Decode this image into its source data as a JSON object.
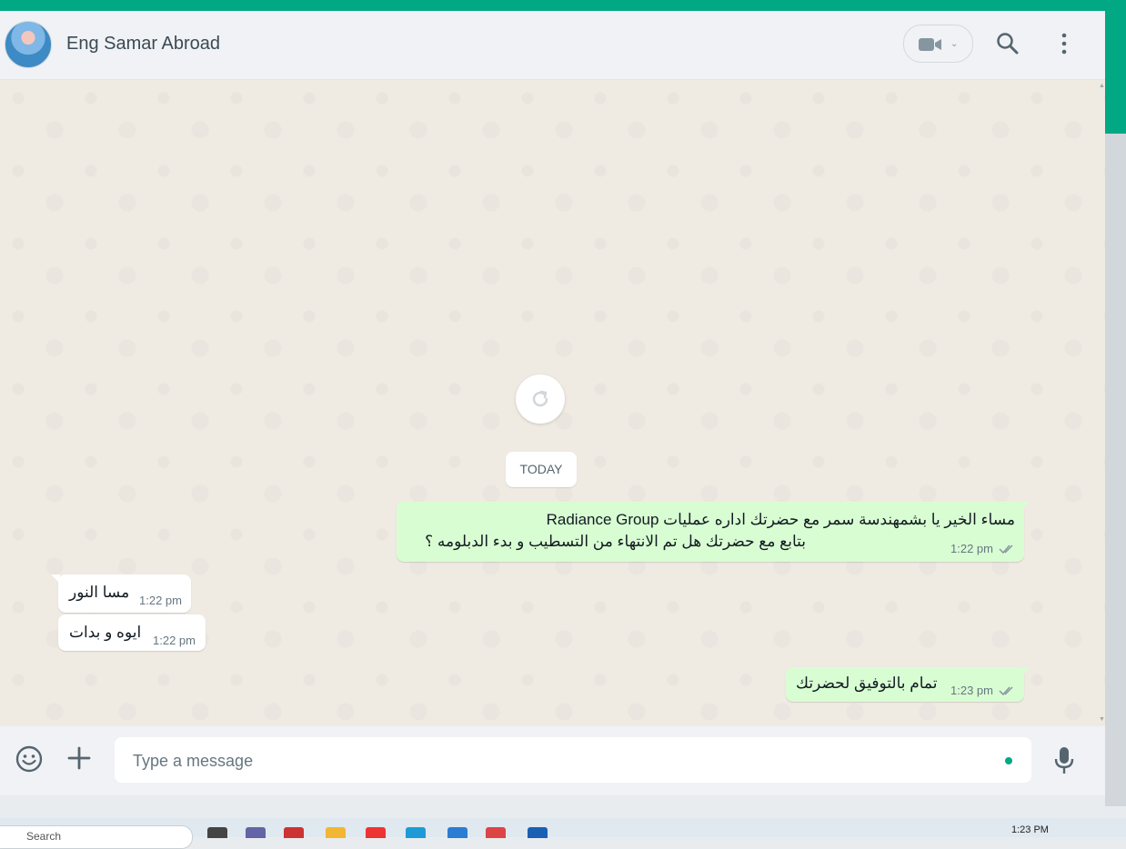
{
  "header": {
    "contact_name": "Eng Samar Abroad",
    "video_icon": "video-camera-icon",
    "search_icon": "search-icon",
    "menu_icon": "menu-icon"
  },
  "chat": {
    "date_chip": "TODAY",
    "reload_icon": "reload-icon",
    "messages": [
      {
        "direction": "outgoing",
        "lines": [
          "مساء الخير يا بشمهندسة سمر مع  حضرتك اداره عمليات Radiance Group",
          "بتابع مع حضرتك هل تم الانتهاء من التسطيب و بدء الدبلومه ؟"
        ],
        "time": "1:22 pm",
        "status": "read"
      },
      {
        "direction": "incoming",
        "lines": [
          "مسا النور"
        ],
        "time": "1:22 pm"
      },
      {
        "direction": "incoming",
        "lines": [
          "ايوه و بدات"
        ],
        "time": "1:22 pm"
      },
      {
        "direction": "outgoing",
        "lines": [
          "تمام بالتوفيق لحضرتك"
        ],
        "time": "1:23 pm",
        "status": "read"
      }
    ]
  },
  "composer": {
    "placeholder": "Type a message",
    "emoji_icon": "emoji-icon",
    "attach_icon": "plus-icon",
    "mic_icon": "microphone-icon"
  },
  "taskbar": {
    "search_label": "Search",
    "clock": "1:23 PM"
  },
  "colors": {
    "accent": "#00a884",
    "outgoing_bubble": "#d9fdd3",
    "incoming_bubble": "#ffffff",
    "chat_background": "#efeae2",
    "read_ticks": "#8696a0"
  }
}
